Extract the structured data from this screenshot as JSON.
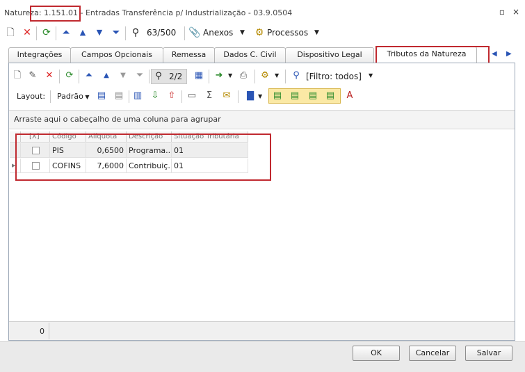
{
  "window": {
    "title": "Natureza: 1.151.01 - Entradas Transferência p/ Industrialização - 03.9.0504",
    "restore_icon": "restore-icon",
    "close_icon": "close-icon"
  },
  "toolbar": {
    "record_counter": "63/500",
    "anexos_label": "Anexos",
    "processos_label": "Processos"
  },
  "tabs": [
    {
      "label": "Integrações"
    },
    {
      "label": "Campos Opcionais"
    },
    {
      "label": "Remessa"
    },
    {
      "label": "Dados C. Civil"
    },
    {
      "label": "Dispositivo Legal"
    },
    {
      "label": "Tributos da Natureza"
    }
  ],
  "inner_toolbar": {
    "record_counter": "2/2",
    "filter_label": "[Filtro: todos]",
    "layout_label": "Layout:",
    "layout_value": "Padrão"
  },
  "grid": {
    "group_hint": "Arraste aqui o cabeçalho de uma coluna para agrupar",
    "columns": [
      "[X]",
      "Código",
      "Alíquota",
      "Descrição",
      "Situação Tributária"
    ],
    "rows": [
      {
        "codigo": "PIS",
        "aliquota": "0,6500",
        "descricao": "Programa...",
        "situacao": "01"
      },
      {
        "codigo": "COFINS",
        "aliquota": "7,6000",
        "descricao": "Contribuiç...",
        "situacao": "01"
      }
    ],
    "footer_count": "0"
  },
  "buttons": {
    "ok": "OK",
    "cancel": "Cancelar",
    "save": "Salvar"
  },
  "colors": {
    "highlight": "#c0292f",
    "frame": "#9aa6b5"
  }
}
